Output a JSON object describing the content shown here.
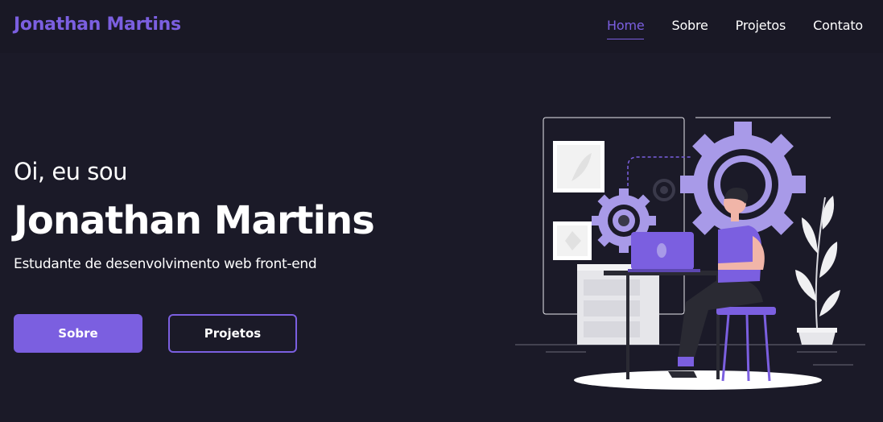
{
  "header": {
    "logo": "Jonathan Martins",
    "nav": [
      {
        "label": "Home",
        "active": true
      },
      {
        "label": "Sobre",
        "active": false
      },
      {
        "label": "Projetos",
        "active": false
      },
      {
        "label": "Contato",
        "active": false
      }
    ]
  },
  "hero": {
    "greeting": "Oi, eu sou",
    "name": "Jonathan Martins",
    "subtitle": "Estudante de desenvolvimento web front-end",
    "buttons": {
      "primary": "Sobre",
      "secondary": "Projetos"
    }
  },
  "colors": {
    "background": "#1b1a28",
    "header_background": "#191825",
    "accent": "#7b5fe0",
    "text": "#ffffff"
  },
  "illustration": {
    "icon": "developer-at-desk-illustration"
  }
}
